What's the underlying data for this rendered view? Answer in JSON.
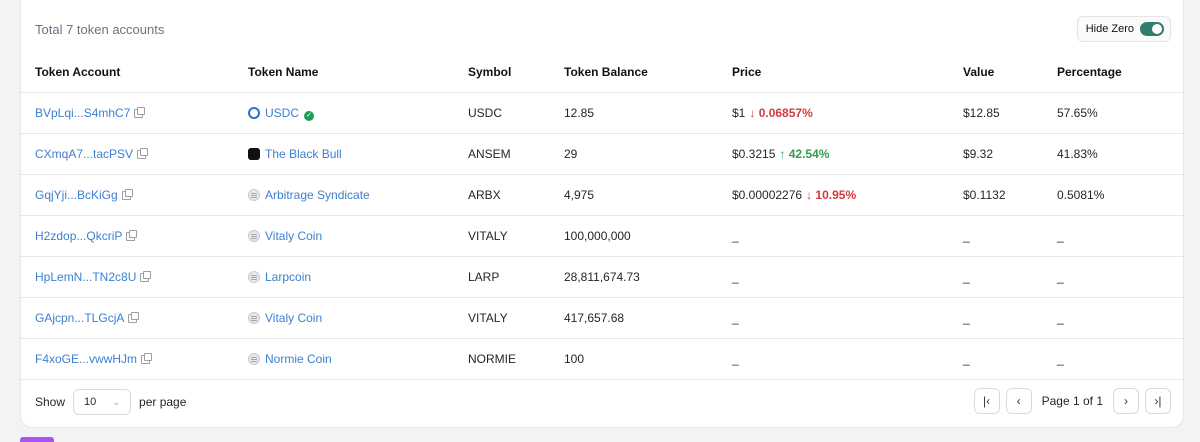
{
  "summary": "Total 7 token accounts",
  "hide_zero": {
    "label": "Hide Zero",
    "on": true
  },
  "columns": [
    "Token Account",
    "Token Name",
    "Symbol",
    "Token Balance",
    "Price",
    "Value",
    "Percentage"
  ],
  "rows": [
    {
      "account": "BVpLqi...S4mhC7",
      "name": "USDC",
      "icon": "usdc-icon",
      "verified": true,
      "symbol": "USDC",
      "balance": "12.85",
      "price": "$1",
      "change": "0.06857%",
      "dir": "down",
      "value": "$12.85",
      "percentage": "57.65%"
    },
    {
      "account": "CXmqA7...tacPSV",
      "name": "The Black Bull",
      "icon": "bull-icon",
      "verified": false,
      "symbol": "ANSEM",
      "balance": "29",
      "price": "$0.3215",
      "change": "42.54%",
      "dir": "up",
      "value": "$9.32",
      "percentage": "41.83%"
    },
    {
      "account": "GqjYji...BcKiGg",
      "name": "Arbitrage Syndicate",
      "icon": "generic-icon",
      "verified": false,
      "symbol": "ARBX",
      "balance": "4,975",
      "price": "$0.00002276",
      "change": "10.95%",
      "dir": "down",
      "value": "$0.1132",
      "percentage": "0.5081%"
    },
    {
      "account": "H2zdop...QkcriP",
      "name": "Vitaly Coin",
      "icon": "generic-icon",
      "verified": false,
      "symbol": "VITALY",
      "balance": "100,000,000",
      "price": "_",
      "change": "",
      "dir": "",
      "value": "_",
      "percentage": "_"
    },
    {
      "account": "HpLemN...TN2c8U",
      "name": "Larpcoin",
      "icon": "generic-icon",
      "verified": false,
      "symbol": "LARP",
      "balance": "28,811,674.73",
      "price": "_",
      "change": "",
      "dir": "",
      "value": "_",
      "percentage": "_"
    },
    {
      "account": "GAjcpn...TLGcjA",
      "name": "Vitaly Coin",
      "icon": "generic-icon",
      "verified": false,
      "symbol": "VITALY",
      "balance": "417,657.68",
      "price": "_",
      "change": "",
      "dir": "",
      "value": "_",
      "percentage": "_"
    },
    {
      "account": "F4xoGE...vwwHJm",
      "name": "Normie Coin",
      "icon": "generic-icon",
      "verified": false,
      "symbol": "NORMIE",
      "balance": "100",
      "price": "_",
      "change": "",
      "dir": "",
      "value": "_",
      "percentage": "_"
    }
  ],
  "footer": {
    "show": "Show",
    "per_page_value": "10",
    "per_page_label": "per page",
    "page_label": "Page 1 of 1"
  },
  "colors": {
    "link": "#3d7fd1",
    "down": "#d33b3b",
    "up": "#2f9d4f",
    "toggle": "#2f7d6d"
  }
}
